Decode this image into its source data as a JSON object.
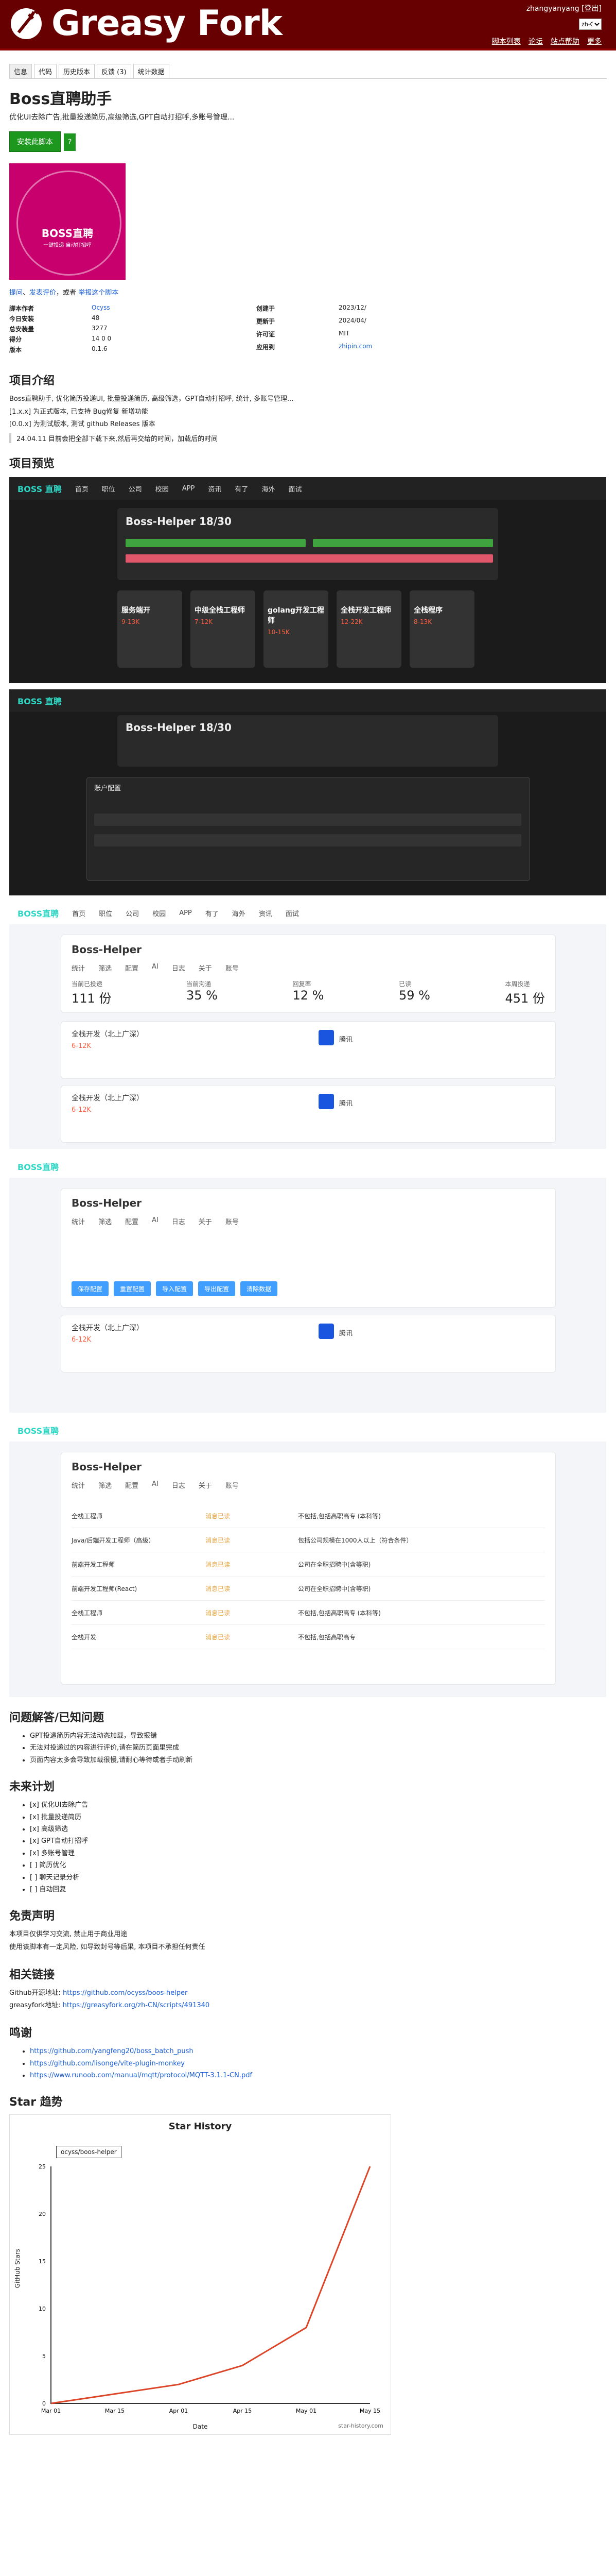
{
  "site": {
    "title": "Greasy Fork",
    "lang": "zh-CN"
  },
  "user_links": [
    "zhangyanyang",
    "登出"
  ],
  "main_nav": [
    "脚本列表",
    "论坛",
    "站点帮助",
    "更多"
  ],
  "tabs": [
    "信息",
    "代码",
    "历史版本",
    "反馈 (3)",
    "统计数据"
  ],
  "script": {
    "title": "Boss直聘助手",
    "description": "优化UI去除广告,批量投递简历,高级筛选,GPT自动打招呼,多账号管理...",
    "install_label": "安装此脚本",
    "install_help": "?",
    "cover_text": "BOSS直聘",
    "cover_sub": "一键投递 自动打招呼",
    "links_text": "提问、发表评价，或者",
    "links_link1": "提问",
    "links_link2": "发表评价",
    "links_link3": "举报这个脚本",
    "meta": [
      {
        "k": "脚本作者",
        "v": "Ocyss"
      },
      {
        "k": "今日安装",
        "v": "48"
      },
      {
        "k": "总安装量",
        "v": "3277"
      },
      {
        "k": "得分",
        "v": "14 0 0"
      },
      {
        "k": "版本",
        "v": "0.1.6"
      },
      {
        "k": "创建于",
        "v": "2023/12/"
      },
      {
        "k": "更新于",
        "v": "2024/04/"
      },
      {
        "k": "许可证",
        "v": "MIT"
      },
      {
        "k": "应用到",
        "v": "zhipin.com"
      }
    ]
  },
  "intro": {
    "heading": "项目介绍",
    "p1": "Boss直聘助手, 优化简历投递UI, 批量投递简历, 高级筛选，GPT自动打招呼, 统计, 多账号管理...",
    "p2": "[1.x.x] 为正式版本, 已支持 Bug修复 新增功能",
    "p3": "[0.0.x] 为测试版本, 测试 github Releases 版本",
    "q1": "24.04.11 目前会把全部下载下来,然后再交给的时间，加载后的时间"
  },
  "preview": {
    "heading": "项目预览"
  },
  "shot1": {
    "brand": "BOSS 直聘",
    "nav": [
      "首页",
      "职位",
      "公司",
      "校园",
      "APP",
      "资讯",
      "有了",
      "海外",
      "面试"
    ],
    "panel_title": "Boss-Helper 18/30",
    "cards": [
      {
        "t": "服务端开",
        "s": "9-13K"
      },
      {
        "t": "中级全栈工程师",
        "s": "7-12K"
      },
      {
        "t": "golang开发工程师",
        "s": "10-15K"
      },
      {
        "t": "全栈开发工程师",
        "s": "12-22K"
      },
      {
        "t": "全栈程序",
        "s": "8-13K"
      }
    ]
  },
  "shot2": {
    "panel_title": "Boss-Helper 18/30",
    "dialog_title": "账户配置"
  },
  "shot3": {
    "brand": "BOSS直聘",
    "nav": [
      "首页",
      "职位",
      "公司",
      "校园",
      "APP",
      "有了",
      "海外",
      "资讯",
      "面试"
    ],
    "panel_title": "Boss-Helper",
    "subtabs": [
      "统计",
      "筛选",
      "配置",
      "AI",
      "日志",
      "关于",
      "账号"
    ],
    "stats": [
      {
        "label": "当前已投递",
        "val": "111 份"
      },
      {
        "label": "当前沟通",
        "val": "35 %"
      },
      {
        "label": "回复率",
        "val": "12 %"
      },
      {
        "label": "已读",
        "val": "59 %"
      },
      {
        "label": "本周投递",
        "val": "451 份"
      }
    ],
    "jobs": [
      {
        "t": "全栈开发（北上广深）",
        "s": "6-12K",
        "c": "腾讯"
      },
      {
        "t": "全栈开发（北上广深）",
        "s": "6-12K",
        "c": "腾讯"
      }
    ]
  },
  "shot4": {
    "panel_title": "Boss-Helper",
    "subtabs": [
      "统计",
      "筛选",
      "配置",
      "AI",
      "日志",
      "关于",
      "账号"
    ],
    "buttons": [
      "保存配置",
      "重置配置",
      "导入配置",
      "导出配置",
      "清除数据"
    ]
  },
  "shot5": {
    "panel_title": "Boss-Helper",
    "subtabs": [
      "统计",
      "筛选",
      "配置",
      "AI",
      "日志",
      "关于",
      "账号"
    ],
    "rows": [
      {
        "a": "全栈工程师",
        "b": "消息已读",
        "c": "不包括,包括高职高专 (本科等)"
      },
      {
        "a": "Java/后端开发工程师（高级）",
        "b": "消息已读",
        "c": "包括公司规模在1000人以上（符合条件）"
      },
      {
        "a": "前端开发工程师",
        "b": "消息已读",
        "c": "公司在全职招聘中(含等职)"
      },
      {
        "a": "前端开发工程师(React)",
        "b": "消息已读",
        "c": "公司在全职招聘中(含等职)"
      },
      {
        "a": "全栈工程师",
        "b": "消息已读",
        "c": "不包括,包括高职高专 (本科等)"
      },
      {
        "a": "全栈开发",
        "b": "消息已读",
        "c": "不包括,包括高职高专"
      }
    ]
  },
  "issues": {
    "heading": "问题解答/已知问题",
    "items": [
      "GPT投递简历内容无法动态加载，导致报错",
      "无法对投递过的内容进行评价,请在简历页面里完成",
      "页面内容太多会导致加载很慢,请耐心等待或者手动刷新"
    ]
  },
  "todo": {
    "heading": "未来计划",
    "items": [
      "[x] 优化UI去除广告",
      "[x] 批量投递简历",
      "[x] 高级筛选",
      "[x] GPT自动打招呼",
      "[x] 多账号管理",
      "[ ] 简历优化",
      "[ ] 聊天记录分析",
      "[ ] 自动回复"
    ]
  },
  "disclaimer": {
    "heading": "免责声明",
    "p1": "本项目仅供学习交流, 禁止用于商业用途",
    "p2": "使用该脚本有一定风险, 如导致封号等后果, 本项目不承担任何责任"
  },
  "related": {
    "heading": "相关链接",
    "github_label": "Github开源地址:",
    "github": "https://github.com/ocyss/boos-helper",
    "greasy_label": "greasyfork地址:",
    "greasy": "https://greasyfork.org/zh-CN/scripts/491340"
  },
  "thanks": {
    "heading": "鸣谢",
    "links": [
      "https://github.com/yangfeng20/boss_batch_push",
      "https://github.com/lisonge/vite-plugin-monkey",
      "https://www.runoob.com/manual/mqtt/protocol/MQTT-3.1.1-CN.pdf"
    ]
  },
  "star": {
    "heading": "Star 趋势",
    "title": "Star History",
    "legend": "ocyss/boos-helper",
    "ylabel": "GitHub Stars",
    "xlabel": "Date",
    "note": "star-history.com"
  },
  "chart_data": {
    "type": "line",
    "title": "Star History",
    "xlabel": "Date",
    "ylabel": "GitHub Stars",
    "x": [
      "Mar 01",
      "Mar 15",
      "Apr 01",
      "Apr 15",
      "May 01",
      "May 15"
    ],
    "series": [
      {
        "name": "ocyss/boos-helper",
        "values": [
          0,
          1,
          2,
          4,
          8,
          26
        ]
      }
    ],
    "ylim": [
      0,
      25
    ]
  }
}
